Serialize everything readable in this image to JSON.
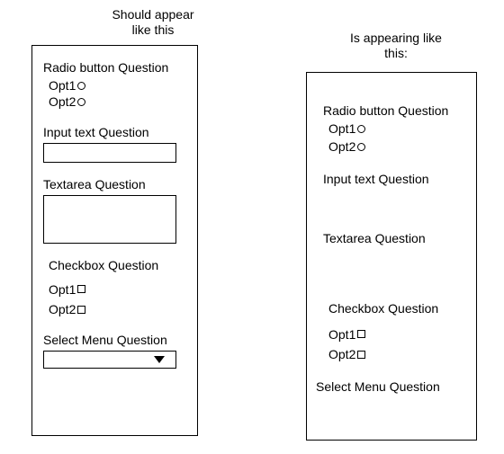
{
  "left": {
    "header_line1": "Should appear",
    "header_line2": "like this",
    "q_radio": "Radio button Question",
    "radio_opt1": "Opt1",
    "radio_opt2": "Opt2",
    "q_input": "Input text Question",
    "q_textarea": "Textarea Question",
    "q_checkbox": "Checkbox Question",
    "check_opt1": "Opt1",
    "check_opt2": "Opt2",
    "q_select": "Select Menu Question"
  },
  "right": {
    "header_line1": "Is appearing like",
    "header_line2": "this:",
    "q_radio": "Radio button Question",
    "radio_opt1": "Opt1",
    "radio_opt2": "Opt2",
    "q_input": "Input text Question",
    "q_textarea": "Textarea Question",
    "q_checkbox": "Checkbox Question",
    "check_opt1": "Opt1",
    "check_opt2": "Opt2",
    "q_select": "Select Menu Question"
  }
}
